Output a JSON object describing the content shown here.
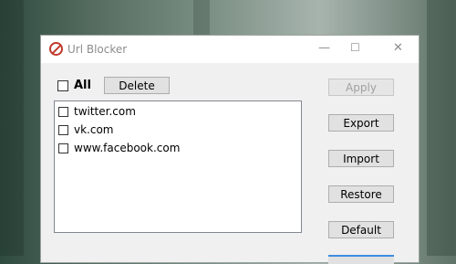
{
  "window": {
    "title": "Url Blocker",
    "controls": {
      "minimize": "—",
      "maximize": "☐",
      "close": "✕"
    }
  },
  "toolbar": {
    "all_label": "All",
    "delete_label": "Delete"
  },
  "sites": [
    {
      "url": "twitter.com",
      "checked": false
    },
    {
      "url": "vk.com",
      "checked": false
    },
    {
      "url": "www.facebook.com",
      "checked": false
    }
  ],
  "side_buttons": {
    "apply": "Apply",
    "export": "Export",
    "import": "Import",
    "restore": "Restore",
    "default": "Default"
  },
  "colors": {
    "accent_blue": "#3c8de0",
    "app_icon_red": "#c0392b"
  }
}
